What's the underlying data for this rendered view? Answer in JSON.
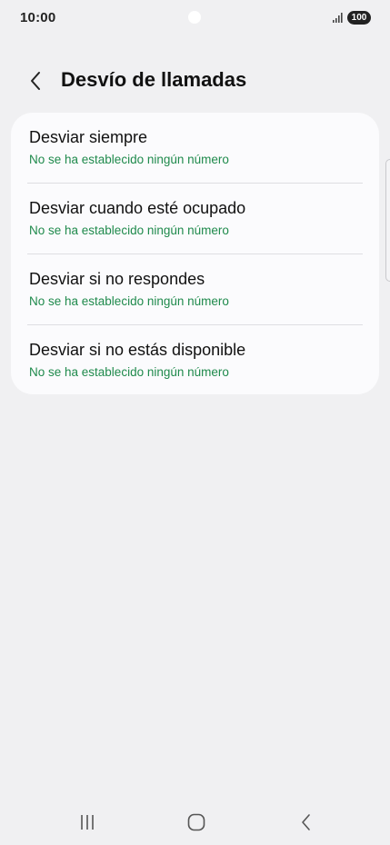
{
  "status_bar": {
    "time": "10:00",
    "battery": "100",
    "signal_icon": "signal-bars-icon"
  },
  "header": {
    "back_icon": "chevron-left-icon",
    "title": "Desvío de llamadas"
  },
  "forwarding_options": [
    {
      "title": "Desviar siempre",
      "subtitle": "No se ha establecido ningún número"
    },
    {
      "title": "Desviar cuando esté ocupado",
      "subtitle": "No se ha establecido ningún número"
    },
    {
      "title": "Desviar si no respondes",
      "subtitle": "No se ha establecido ningún número"
    },
    {
      "title": "Desviar si no estás disponible",
      "subtitle": "No se ha establecido ningún número"
    }
  ],
  "colors": {
    "background": "#f0f0f2",
    "card": "#fbfbfd",
    "subtitle_green": "#1f8a4c"
  },
  "navigation_bar": {
    "recents_icon": "recents-icon",
    "home_icon": "home-icon",
    "back_icon": "back-icon"
  }
}
